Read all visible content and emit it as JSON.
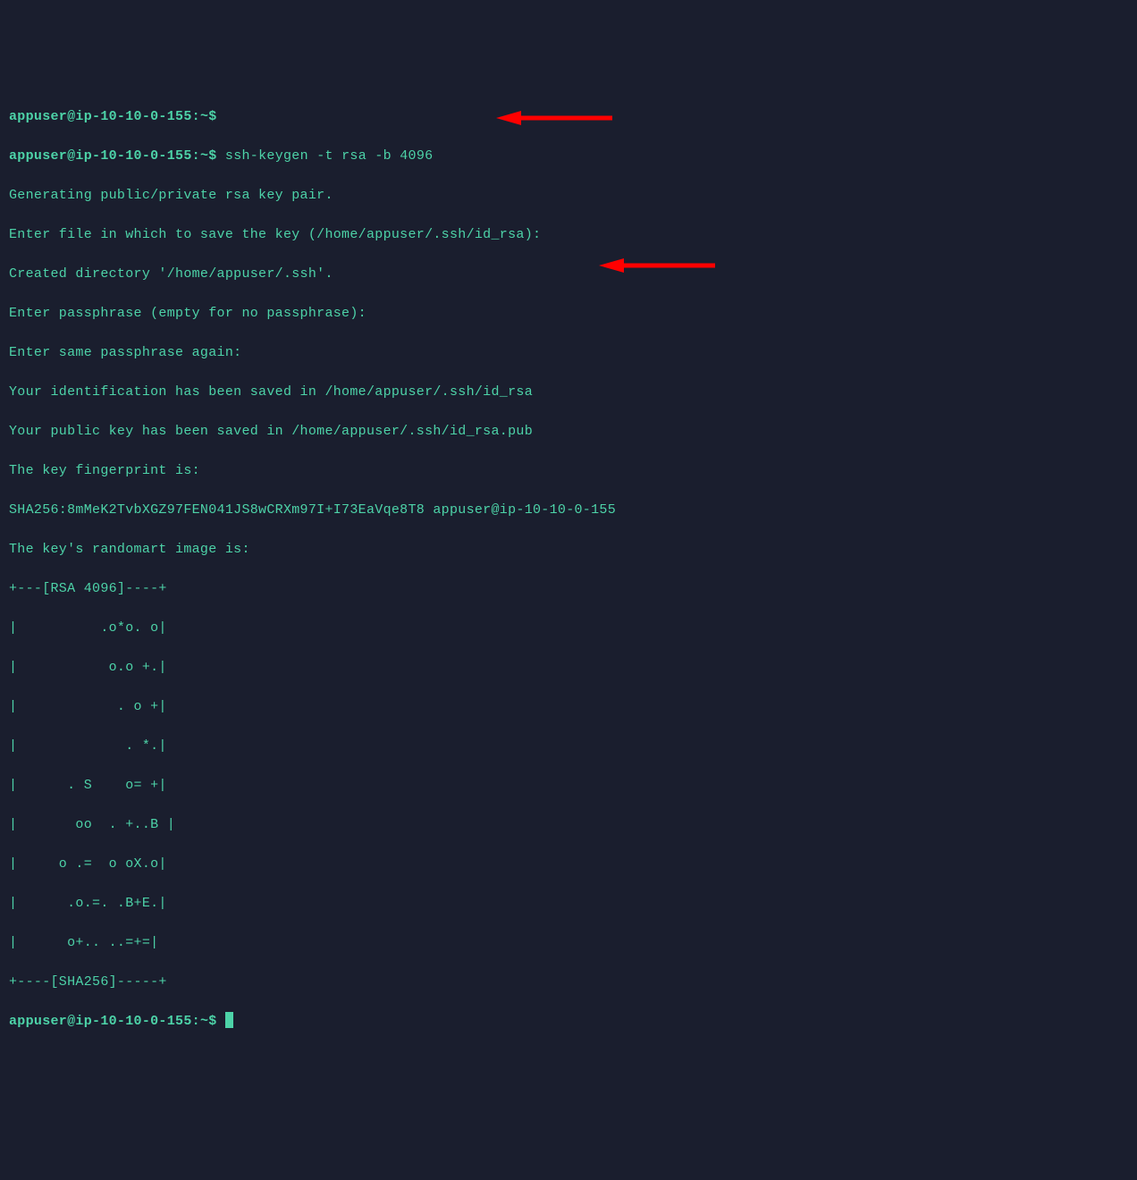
{
  "terminal": {
    "prompt_user_host": "appuser@ip-10-10-0-155",
    "prompt_separator": ":",
    "prompt_tilde": "~",
    "prompt_dollar": "$",
    "command": "ssh-keygen -t rsa -b 4096",
    "output_lines": [
      "Generating public/private rsa key pair.",
      "Enter file in which to save the key (/home/appuser/.ssh/id_rsa):",
      "Created directory '/home/appuser/.ssh'.",
      "Enter passphrase (empty for no passphrase):",
      "Enter same passphrase again:",
      "Your identification has been saved in /home/appuser/.ssh/id_rsa",
      "Your public key has been saved in /home/appuser/.ssh/id_rsa.pub",
      "The key fingerprint is:",
      "SHA256:8mMeK2TvbXGZ97FEN041JS8wCRXm97I+I73EaVqe8T8 appuser@ip-10-10-0-155",
      "The key's randomart image is:",
      "+---[RSA 4096]----+",
      "|          .o*o. o|",
      "|           o.o +.|",
      "|            . o +|",
      "|             . *.|",
      "|      . S    o= +|",
      "|       oo  . +..B |",
      "|     o .=  o oX.o|",
      "|      .o.=. .B+E.|",
      "|      o+.. ..=+=|",
      "+----[SHA256]-----+"
    ]
  }
}
